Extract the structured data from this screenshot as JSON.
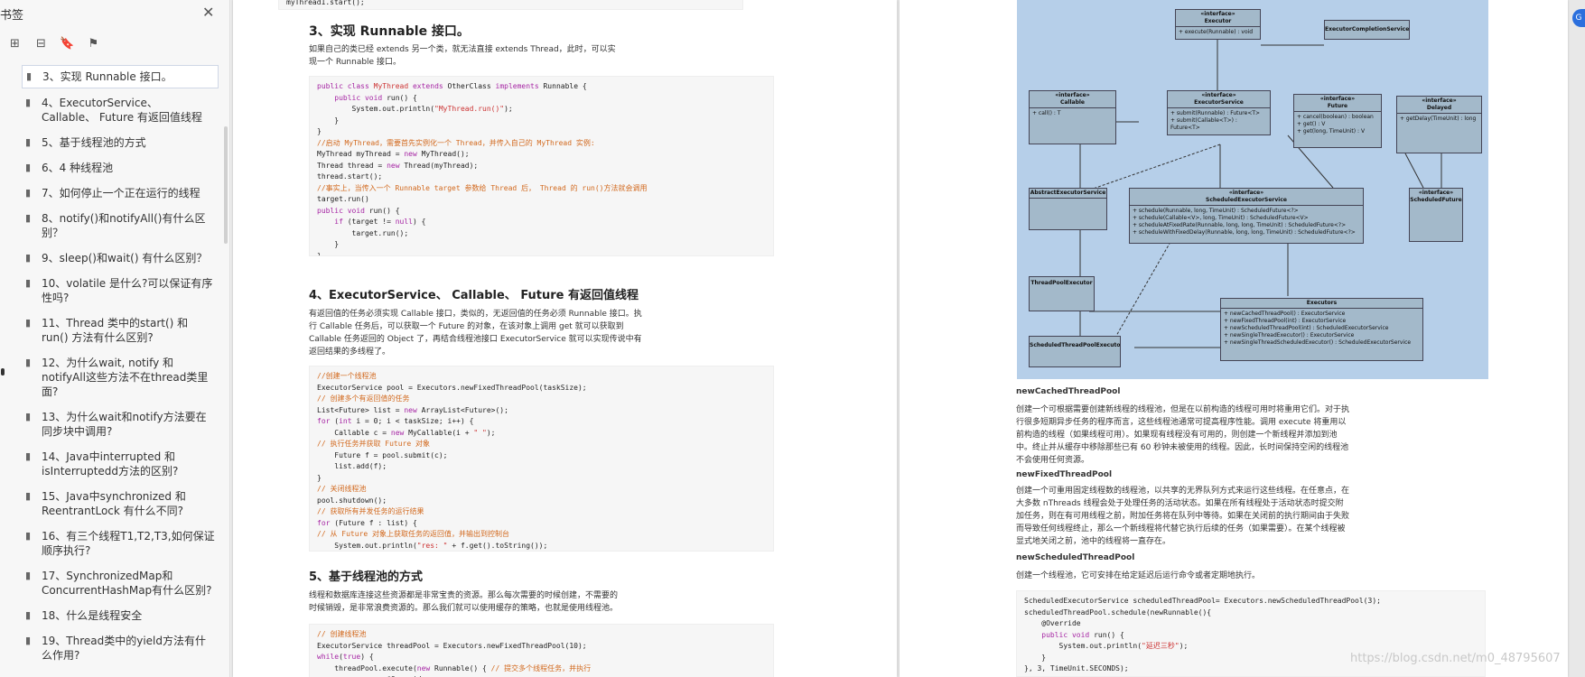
{
  "sidebar": {
    "title": "书签",
    "items": [
      "3、实现 Runnable 接口。",
      "4、ExecutorService、 Callable、 Future 有返回值线程",
      "5、基于线程池的方式",
      "6、4 种线程池",
      "7、如何停止一个正在运行的线程",
      "8、notify()和notifyAll()有什么区别？",
      "9、sleep()和wait() 有什么区别？",
      "10、volatile 是什么?可以保证有序性吗?",
      "11、Thread 类中的start() 和 run() 方法有什么区别?",
      "12、为什么wait, notify 和 notifyAll这些方法不在thread类里面?",
      "13、为什么wait和notify方法要在同步块中调用?",
      "14、Java中interrupted 和 isInterruptedd方法的区别?",
      "15、Java中synchronized 和 ReentrantLock 有什么不同?",
      "16、有三个线程T1,T2,T3,如何保证顺序执行?",
      "17、SynchronizedMap和ConcurrentHashMap有什么区别?",
      "18、什么是线程安全",
      "19、Thread类中的yield方法有什么作用?"
    ]
  },
  "page1": {
    "top_code": "myThread1.start();",
    "h3": "3、实现 Runnable 接口。",
    "p3": "如果自己的类已经 extends 另一个类，就无法直接 extends Thread，此时，可以实现一个 Runnable 接口。",
    "h4": "4、ExecutorService、 Callable、 Future 有返回值线程",
    "p4": "有返回值的任务必须实现 Callable 接口，类似的，无返回值的任务必须 Runnable 接口。执行 Callable 任务后，可以获取一个 Future 的对象，在该对象上调用 get 就可以获取到 Callable 任务返回的 Object 了，再结合线程池接口 ExecutorService 就可以实现传说中有返回结果的多线程了。",
    "h5": "5、基于线程池的方式",
    "p5": "线程和数据库连接这些资源都是非常宝贵的资源。那么每次需要的时候创建，不需要的时候销毁，是非常浪费资源的。那么我们就可以使用缓存的策略，也就是使用线程池。"
  },
  "page2": {
    "uml": {
      "executor": "«interface»\nExecutor",
      "executor_body": "+ execute(Runnable) : void",
      "ecs": "ExecutorCompletionService",
      "callable": "«interface»\nCallable",
      "callable_body": "+ call() : T",
      "es": "«interface»\nExecutorService",
      "es_body": "+ submit(Runnable) : Future<T>\n+ submit(Callable<T>) : Future<T>",
      "future": "«interface»\nFuture",
      "future_body": "+ cancel(boolean) : boolean\n+ get() : V\n+ get(long, TimeUnit) : V",
      "delayed": "«interface»\nDelayed",
      "delayed_body": "+ getDelay(TimeUnit) : long",
      "aes": "AbstractExecutorService",
      "ses": "«interface»\nScheduledExecutorService",
      "ses_body": "+ schedule(Runnable, long, TimeUnit) : ScheduledFuture<?>\n+ schedule(Callable<V>, long, TimeUnit) : ScheduledFuture<V>\n+ scheduleAtFixedRate(Runnable, long, long, TimeUnit) : ScheduledFuture<?>\n+ scheduleWithFixedDelay(Runnable, long, long, TimeUnit) : ScheduledFuture<?>",
      "sf": "«interface»\nScheduledFuture",
      "tpe": "ThreadPoolExecutor",
      "executors": "Executors",
      "executors_body": "+ newCachedThreadPool() : ExecutorService\n+ newFixedThreadPool(int) : ExecutorService\n+ newScheduledThreadPool(int) : ScheduledExecutorService\n+ newSingleThreadExecutor() : ExecutorService\n+ newSingleThreadScheduledExecutor() : ScheduledExecutorService",
      "stpe": "ScheduledThreadPoolExecutor"
    },
    "h_cached": "newCachedThreadPool",
    "p_cached": "创建一个可根据需要创建新线程的线程池，但是在以前构造的线程可用时将重用它们。对于执行很多短期异步任务的程序而言，这些线程池通常可提高程序性能。调用 execute 将重用以前构造的线程（如果线程可用）。如果现有线程没有可用的，则创建一个新线程并添加到池中。终止并从缓存中移除那些已有 60 秒钟未被使用的线程。因此，长时间保持空闲的线程池不会使用任何资源。",
    "h_fixed": "newFixedThreadPool",
    "p_fixed": "创建一个可重用固定线程数的线程池，以共享的无界队列方式来运行这些线程。在任意点，在大多数 nThreads 线程会处于处理任务的活动状态。如果在所有线程处于活动状态时提交附加任务，则在有可用线程之前，附加任务将在队列中等待。如果在关闭前的执行期间由于失败而导致任何线程终止，那么一个新线程将代替它执行后续的任务（如果需要）。在某个线程被显式地关闭之前，池中的线程将一直存在。",
    "h_sched": "newScheduledThreadPool",
    "p_sched": "创建一个线程池，它可安排在给定延迟后运行命令或者定期地执行。"
  },
  "watermark": "https://blog.csdn.net/m0_48795607"
}
